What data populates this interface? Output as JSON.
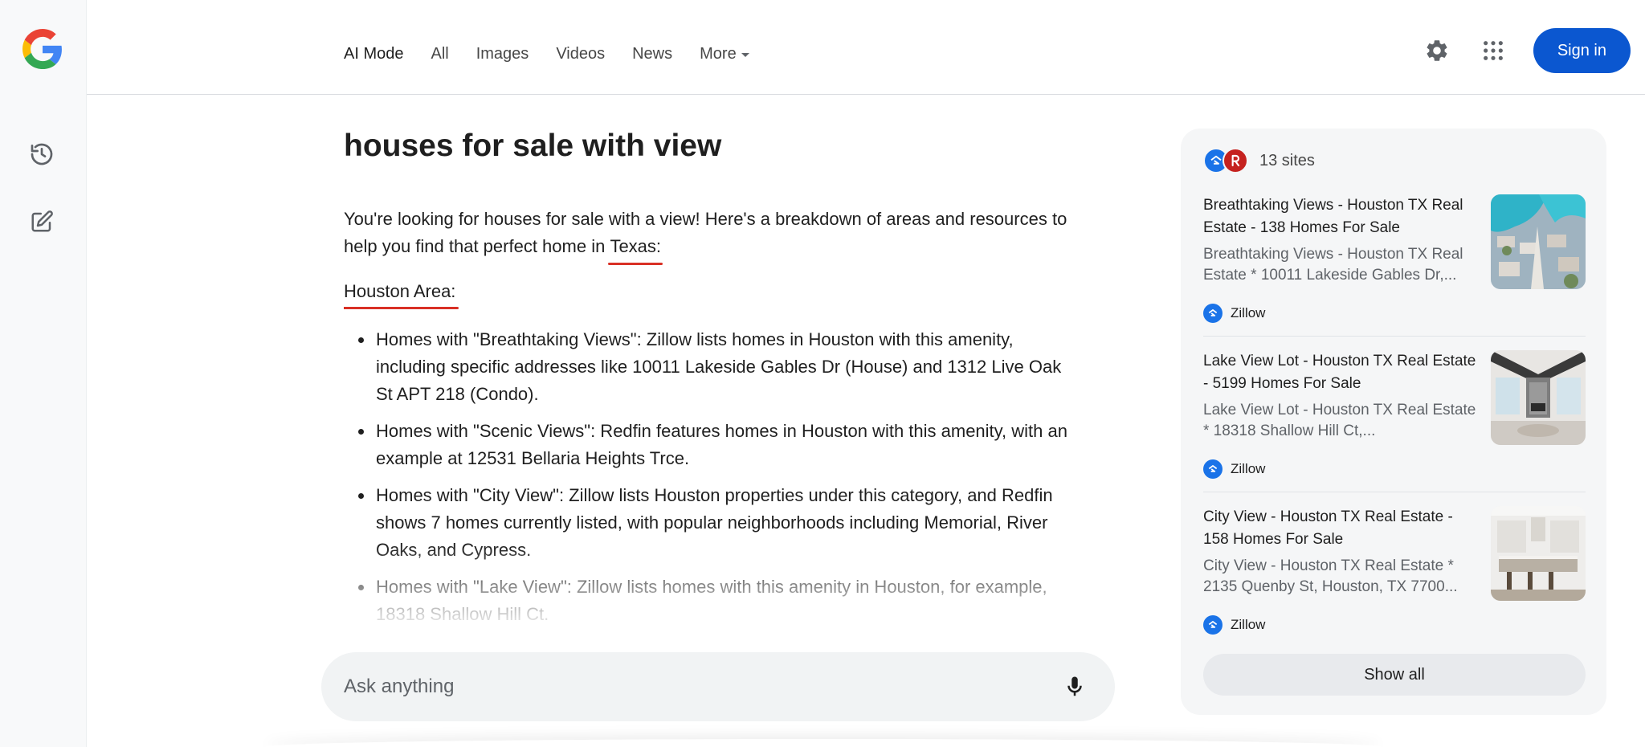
{
  "header": {
    "tabs": [
      {
        "label": "AI Mode",
        "active": true
      },
      {
        "label": "All"
      },
      {
        "label": "Images"
      },
      {
        "label": "Videos"
      },
      {
        "label": "News"
      },
      {
        "label": "More"
      }
    ],
    "sign_in": "Sign in"
  },
  "main": {
    "query": "houses for sale with view",
    "intro_before": "You're looking for houses for sale with a view! Here's a breakdown of areas and resources to help you find that perfect home in ",
    "intro_highlight": "Texas:",
    "section_title": "Houston Area:",
    "bullets": [
      "Homes with \"Breathtaking Views\": Zillow lists homes in Houston with this amenity, including specific addresses like 10011 Lakeside Gables Dr (House) and 1312 Live Oak St APT 218 (Condo).",
      "Homes with \"Scenic Views\": Redfin features homes in Houston with this amenity, with an example at 12531 Bellaria Heights Trce.",
      "Homes with \"City View\": Zillow lists Houston properties under this category, and Redfin shows 7 homes currently listed, with popular neighborhoods including Memorial, River Oaks, and Cypress.",
      "Homes with \"Lake View\": Zillow lists homes with this amenity in Houston, for example, 18318 Shallow Hill Ct."
    ]
  },
  "ask": {
    "placeholder": "Ask anything"
  },
  "sources": {
    "count_label": "13 sites",
    "cards": [
      {
        "title": "Breathtaking Views - Houston TX Real Estate - 138 Homes For Sale",
        "snippet": "Breathtaking Views - Houston TX Real Estate * 10011 Lakeside Gables Dr,...",
        "source": "Zillow"
      },
      {
        "title": "Lake View Lot - Houston TX Real Estate - 5199 Homes For Sale",
        "snippet": "Lake View Lot - Houston TX Real Estate * 18318 Shallow Hill Ct,...",
        "source": "Zillow"
      },
      {
        "title": "City View - Houston TX Real Estate - 158 Homes For Sale",
        "snippet": "City View - Houston TX Real Estate * 2135 Quenby St, Houston, TX 7700...",
        "source": "Zillow"
      }
    ],
    "show_all": "Show all"
  },
  "colors": {
    "accent": "#0b57d0",
    "annotation_red": "#d93025"
  }
}
